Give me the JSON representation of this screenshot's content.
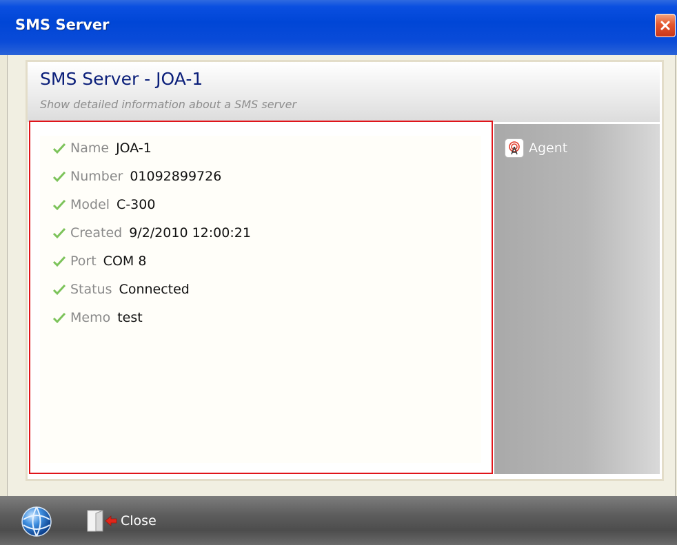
{
  "window": {
    "title": "SMS Server"
  },
  "header": {
    "title": "SMS Server - JOA-1",
    "subtitle": "Show detailed information about a SMS server"
  },
  "details": [
    {
      "label": "Name",
      "value": "JOA-1"
    },
    {
      "label": "Number",
      "value": "01092899726"
    },
    {
      "label": "Model",
      "value": "C-300"
    },
    {
      "label": "Created",
      "value": "9/2/2010 12:00:21"
    },
    {
      "label": "Port",
      "value": "COM 8"
    },
    {
      "label": "Status",
      "value": "Connected"
    },
    {
      "label": "Memo",
      "value": "test"
    }
  ],
  "side": {
    "agent_label": "Agent",
    "agent_icon": "antenna-icon"
  },
  "footer": {
    "close_label": "Close",
    "globe_icon": "globe-icon",
    "close_icon": "exit-door-icon"
  },
  "colors": {
    "highlight_border": "#e0141a",
    "title_bar": "#0046d6",
    "check": "#7cc35a"
  }
}
